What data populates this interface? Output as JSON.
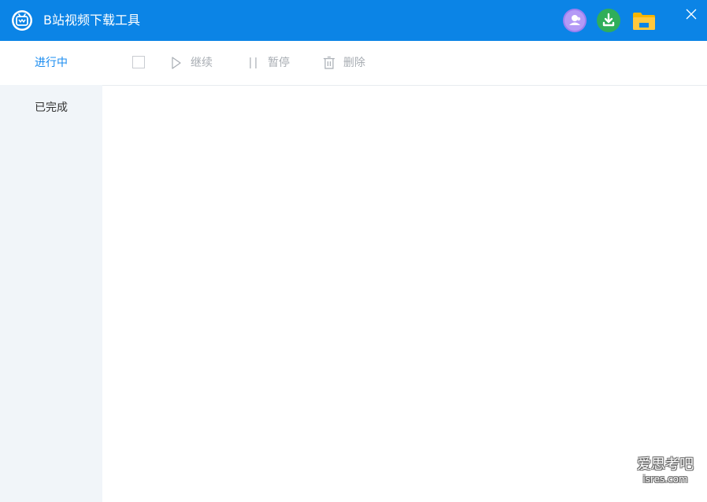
{
  "window": {
    "title": "B站视频下载工具",
    "logo_icon": "bilibili-tv-logo-icon",
    "accent_color": "#0b84e6",
    "buttons": {
      "avatar_icon": "user-avatar-icon",
      "download_icon": "download-icon",
      "folder_icon": "folder-icon",
      "close_icon": "close-icon"
    }
  },
  "sidebar": {
    "items": [
      {
        "label": "进行中",
        "active": true
      },
      {
        "label": "已完成",
        "active": false
      }
    ]
  },
  "toolbar": {
    "select_all_icon": "checkbox-icon",
    "continue_label": "继续",
    "continue_icon": "play-outline-icon",
    "pause_label": "暂停",
    "pause_icon": "pause-icon",
    "delete_label": "删除",
    "delete_icon": "trash-icon"
  },
  "watermark": {
    "line1": "爱思考吧",
    "line2": "isres.com"
  }
}
